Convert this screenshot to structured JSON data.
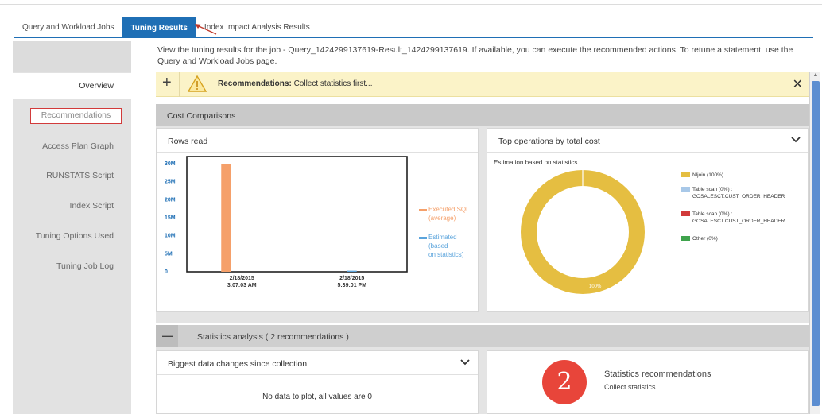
{
  "tabs": [
    {
      "label": "Query and Workload Jobs"
    },
    {
      "label": "Tuning Results"
    },
    {
      "label": "Index Impact Analysis Results"
    }
  ],
  "sidebar": {
    "items": [
      {
        "label": "Overview"
      },
      {
        "label": "Recommendations"
      },
      {
        "label": "Access Plan Graph"
      },
      {
        "label": "RUNSTATS Script"
      },
      {
        "label": "Index Script"
      },
      {
        "label": "Tuning Options Used"
      },
      {
        "label": "Tuning Job Log"
      }
    ]
  },
  "intro_text": "View the tuning results for the job - Query_1424299137619-Result_1424299137619. If available, you can execute the recommended actions. To retune a statement, use the Query and Workload Jobs page.",
  "banner": {
    "plus": "+",
    "label": "Recommendations:",
    "message": "Collect statistics first...",
    "close": "✕"
  },
  "cost_comparisons": {
    "title": "Cost Comparisons"
  },
  "rows_read": {
    "title": "Rows read"
  },
  "top_ops": {
    "title": "Top operations by total cost",
    "subtitle": "Estimation based on statistics",
    "center_label": "100%"
  },
  "statistics_analysis": {
    "toggle": "—",
    "title": "Statistics analysis ( 2 recommendations )"
  },
  "biggest_changes": {
    "title": "Biggest data changes since collection",
    "empty": "No data to plot, all values are 0"
  },
  "stats_recs": {
    "count": "2",
    "title": "Statistics recommendations",
    "subtitle": "Collect statistics"
  },
  "colors": {
    "tab_active": "#1f6fb5",
    "executed": "#f5a06a",
    "estimated": "#5ba4dc",
    "nljoin": "#e5be41",
    "table_scan_1": "#a8c8e8",
    "table_scan_2": "#d13a3a",
    "other": "#3fa34d",
    "badge": "#e8453a"
  },
  "chart_data": [
    {
      "type": "bar",
      "title": "Rows read",
      "categories": [
        "2/18/2015\n3:07:03 AM",
        "2/18/2015\n5:39:01 PM"
      ],
      "series": [
        {
          "name": "Executed SQL (average)",
          "values": [
            30000000,
            0
          ]
        },
        {
          "name": "Estimated (based on statistics)",
          "values": [
            0,
            300000
          ]
        }
      ],
      "ylim": [
        0,
        32000000
      ],
      "yticks": [
        "0",
        "5M",
        "10M",
        "15M",
        "20M",
        "25M",
        "30M"
      ],
      "ytick_values": [
        0,
        5000000,
        10000000,
        15000000,
        20000000,
        25000000,
        30000000
      ],
      "legend": [
        {
          "text": "Executed SQL (average)",
          "color": "#f5a06a"
        },
        {
          "text": "Estimated (based on statistics)",
          "color": "#5ba4dc"
        }
      ],
      "legend_position": "right"
    },
    {
      "type": "pie",
      "title": "Top operations by total cost",
      "subtitle": "Estimation based on statistics",
      "slices": [
        {
          "label": "Nljoin (100%)",
          "value": 100,
          "color": "#e5be41"
        },
        {
          "label": "Table scan (0%) : GOSALESCT.CUST_ORDER_HEADER",
          "value": 0,
          "color": "#a8c8e8"
        },
        {
          "label": "Table scan (0%) : GOSALESCT.CUST_ORDER_HEADER",
          "value": 0,
          "color": "#d13a3a"
        },
        {
          "label": "Other (0%)",
          "value": 0,
          "color": "#3fa34d"
        }
      ],
      "legend_position": "right"
    }
  ]
}
